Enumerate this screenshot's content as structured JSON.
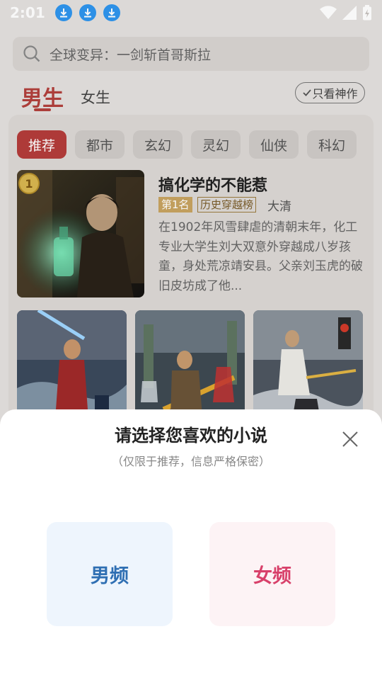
{
  "status_bar": {
    "time": "2:01"
  },
  "search": {
    "placeholder": "全球变异：一剑斩首哥斯拉"
  },
  "gender_tabs": {
    "male": "男生",
    "female": "女生"
  },
  "only_god_label": "只看神作",
  "categories": [
    "推荐",
    "都市",
    "玄幻",
    "灵幻",
    "仙侠",
    "科幻"
  ],
  "featured": {
    "rank_number": "1",
    "title": "搞化学的不能惹",
    "rank_badge": "第1名",
    "list_badge": "历史穿越榜",
    "author": "大清",
    "description": "在1902年风雪肆虐的清朝末年，化工专业大学生刘大双意外穿越成八岁孩童，身处荒凉靖安县。父亲刘玉虎的破旧皮坊成了他..."
  },
  "sheet": {
    "title": "请选择您喜欢的小说",
    "subtitle": "（仅限于推荐，信息严格保密）",
    "male_option": "男频",
    "female_option": "女频"
  },
  "icons": [
    "download-icon",
    "wifi-icon",
    "signal-icon",
    "battery-icon",
    "search-icon",
    "check-icon",
    "close-icon"
  ],
  "colors": {
    "accent": "#b43c3a",
    "male": "#2f6fb3",
    "female": "#d8406a"
  }
}
